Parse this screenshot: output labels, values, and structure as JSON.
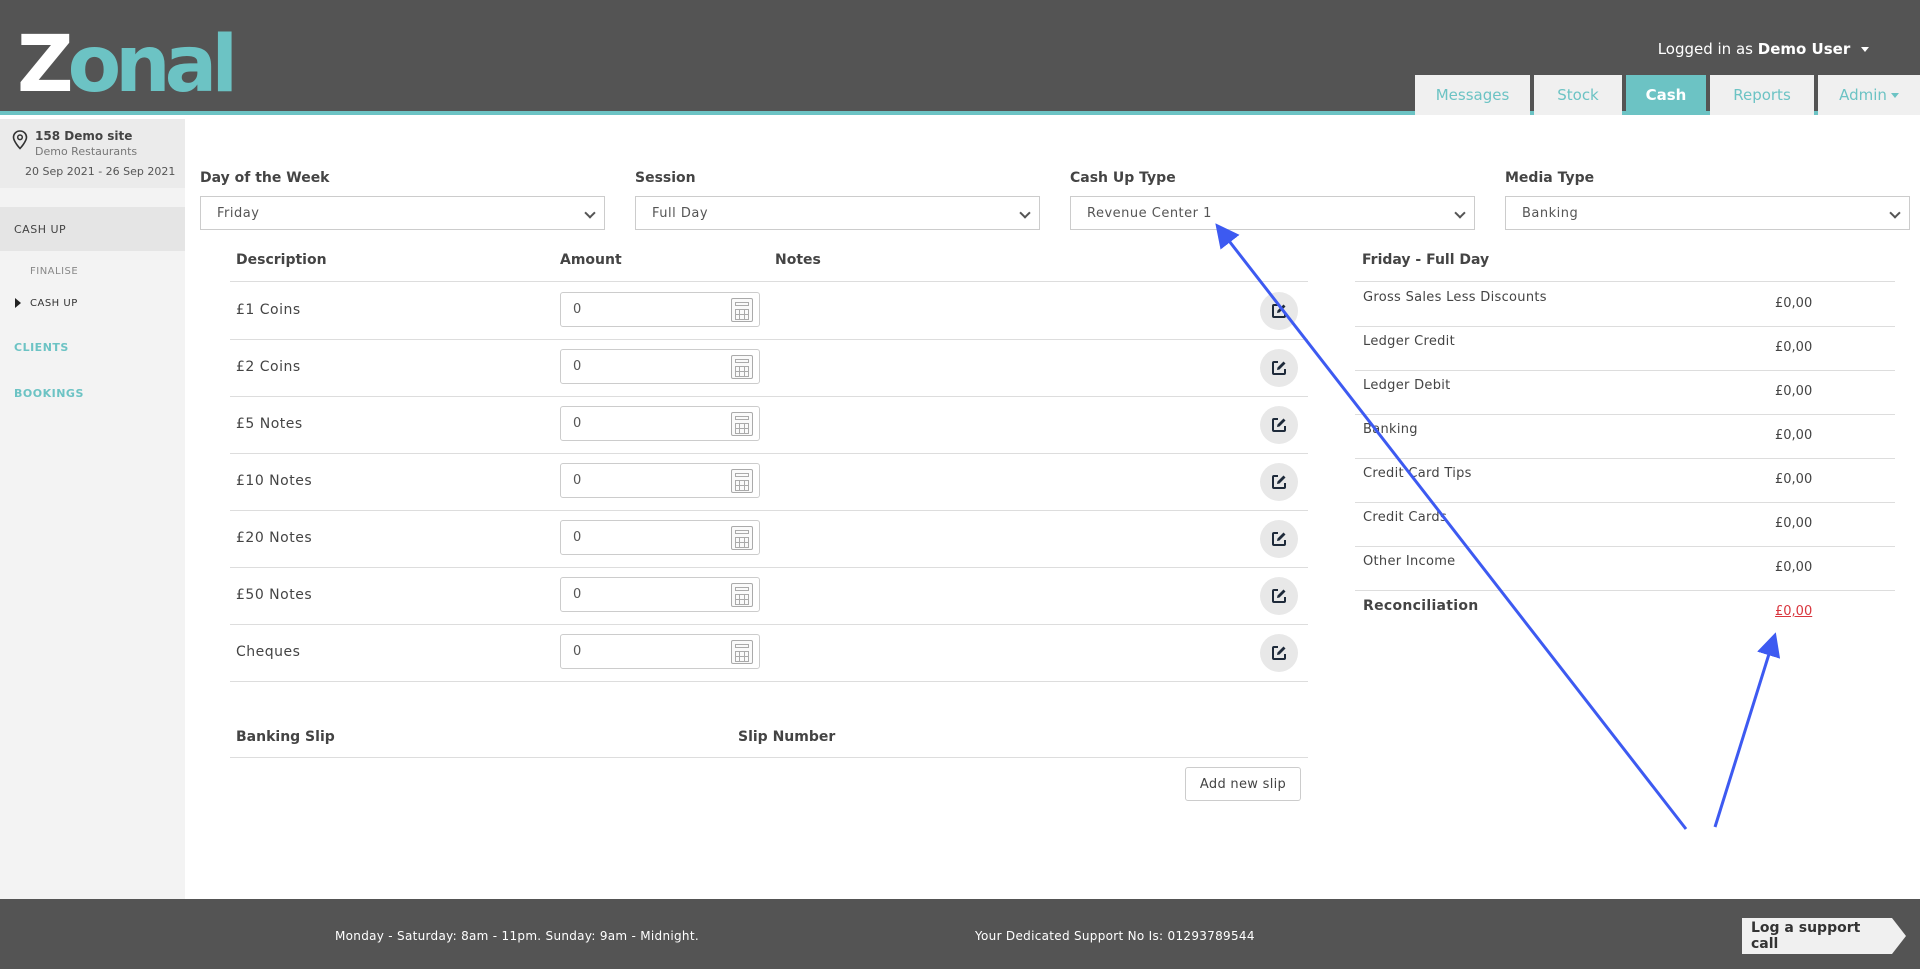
{
  "brand": {
    "logo_prefix": "Z",
    "logo_rest": "onal",
    "accent_color": "#6cc3c4",
    "header_color": "#545454"
  },
  "user": {
    "prefix": "Logged in as",
    "name": "Demo User"
  },
  "tabs": [
    {
      "label": "Messages"
    },
    {
      "label": "Stock"
    },
    {
      "label": "Cash"
    },
    {
      "label": "Reports"
    },
    {
      "label": "Admin"
    }
  ],
  "site": {
    "name": "158 Demo site",
    "company": "Demo Restaurants",
    "date_range": "20 Sep 2021 - 26 Sep 2021"
  },
  "nav": {
    "cash_up": "CASH UP",
    "finalise": "FINALISE",
    "cash_up_sub": "CASH UP",
    "clients": "CLIENTS",
    "bookings": "BOOKINGS"
  },
  "filters": {
    "day": {
      "label": "Day of the Week",
      "value": "Friday"
    },
    "session": {
      "label": "Session",
      "value": "Full Day"
    },
    "cash_up_type": {
      "label": "Cash Up Type",
      "value": "Revenue Center 1"
    },
    "media_type": {
      "label": "Media Type",
      "value": "Banking"
    }
  },
  "table": {
    "headers": {
      "description": "Description",
      "amount": "Amount",
      "notes": "Notes"
    },
    "rows": [
      {
        "description": "£1 Coins",
        "amount": "0"
      },
      {
        "description": "£2 Coins",
        "amount": "0"
      },
      {
        "description": "£5 Notes",
        "amount": "0"
      },
      {
        "description": "£10 Notes",
        "amount": "0"
      },
      {
        "description": "£20 Notes",
        "amount": "0"
      },
      {
        "description": "£50 Notes",
        "amount": "0"
      },
      {
        "description": "Cheques",
        "amount": "0"
      }
    ]
  },
  "banking": {
    "slip_label": "Banking Slip",
    "slip_number_label": "Slip Number",
    "add_button": "Add new slip"
  },
  "summary": {
    "title": "Friday - Full Day",
    "rows": [
      {
        "label": "Gross Sales Less Discounts",
        "value": "£0,00"
      },
      {
        "label": "Ledger Credit",
        "value": "£0,00"
      },
      {
        "label": "Ledger Debit",
        "value": "£0,00"
      },
      {
        "label": "Banking",
        "value": "£0,00"
      },
      {
        "label": "Credit Card Tips",
        "value": "£0,00"
      },
      {
        "label": "Credit Cards",
        "value": "£0,00"
      },
      {
        "label": "Other Income",
        "value": "£0,00"
      }
    ],
    "reconciliation": {
      "label": "Reconciliation",
      "value": "£0,00",
      "color": "#d9363e"
    }
  },
  "footer": {
    "hours": "Monday - Saturday: 8am - 11pm. Sunday: 9am - Midnight.",
    "support": "Your Dedicated Support No Is: 01293789544",
    "log_button": "Log a support call"
  },
  "annotation": {
    "arrow_color": "#3d5af1"
  }
}
